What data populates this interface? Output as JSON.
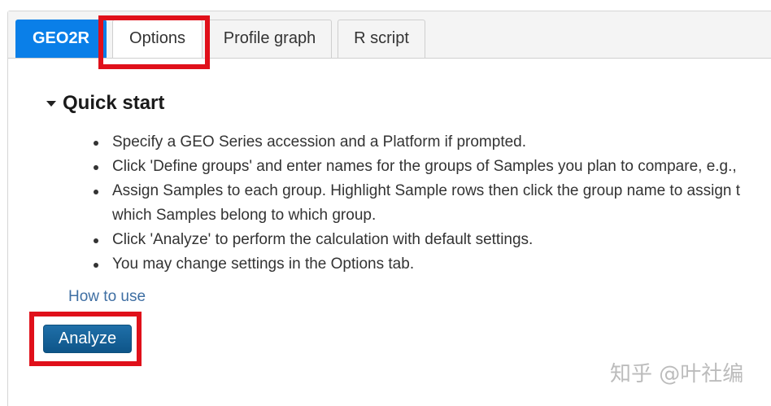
{
  "tabs": [
    {
      "label": "GEO2R",
      "active": true
    },
    {
      "label": "Options",
      "active": false
    },
    {
      "label": "Profile graph",
      "active": false
    },
    {
      "label": "R script",
      "active": false
    }
  ],
  "quick_start": {
    "title": "Quick start",
    "expanded": true,
    "steps": [
      {
        "text": "Specify a GEO Series accession and a Platform if prompted."
      },
      {
        "text": "Click 'Define groups' and enter names for the groups of Samples you plan to compare, e.g.,"
      },
      {
        "text": "Assign Samples to each group. Highlight Sample rows then click the group name to assign t",
        "continuation": "which Samples belong to which group."
      },
      {
        "text": "Click 'Analyze' to perform the calculation with default settings."
      },
      {
        "text": "You may change settings in the Options tab."
      }
    ],
    "how_to_use_link": "How to use",
    "analyze_button": "Analyze"
  },
  "watermark": "知乎 @叶社编",
  "colors": {
    "active_tab": "#0a7fe8",
    "highlight_box": "#e0101a",
    "analyze_button": "#0e5589",
    "link": "#3f6fa3"
  }
}
